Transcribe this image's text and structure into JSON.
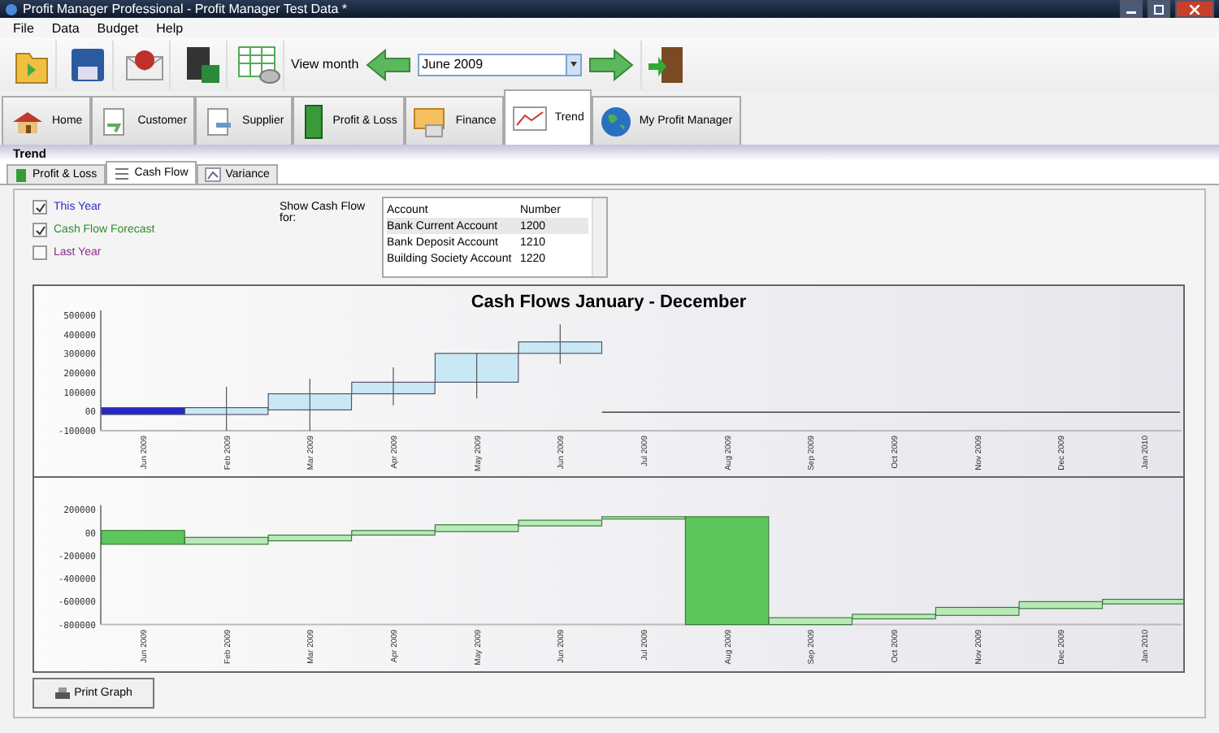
{
  "window": {
    "title": "Profit Manager Professional - Profit Manager Test Data *"
  },
  "menu": [
    "File",
    "Data",
    "Budget",
    "Help"
  ],
  "toolbar": {
    "view_month_label": "View month",
    "month": "June 2009"
  },
  "nav_tabs": [
    {
      "label": "Home",
      "selected": false
    },
    {
      "label": "Customer",
      "selected": false
    },
    {
      "label": "Supplier",
      "selected": false
    },
    {
      "label": "Profit & Loss",
      "selected": false
    },
    {
      "label": "Finance",
      "selected": false
    },
    {
      "label": "Trend",
      "selected": true
    },
    {
      "label": "My Profit Manager",
      "selected": false
    }
  ],
  "section_title": "Trend",
  "sub_tabs": [
    {
      "label": "Profit & Loss",
      "selected": false
    },
    {
      "label": "Cash Flow",
      "selected": true
    },
    {
      "label": "Variance",
      "selected": false
    }
  ],
  "series_toggles": [
    {
      "label": "This Year",
      "checked": true,
      "color": "#2b2bc8"
    },
    {
      "label": "Cash Flow Forecast",
      "checked": true,
      "color": "#2e8b2e"
    },
    {
      "label": "Last Year",
      "checked": false,
      "color": "#8a2b8a"
    }
  ],
  "show_cash_flow_label": "Show Cash Flow for:",
  "accounts": {
    "columns": [
      "Account",
      "Number"
    ],
    "rows": [
      {
        "cells": [
          "Bank Current Account",
          "1200"
        ],
        "selected": true
      },
      {
        "cells": [
          "Bank Deposit Account",
          "1210"
        ],
        "selected": false
      },
      {
        "cells": [
          "Building Society Account",
          "1220"
        ],
        "selected": false
      }
    ]
  },
  "charts": [
    {
      "kind": "cash-flow",
      "title": "Cash Flows January - December",
      "y_axis_labels": [
        "500000",
        "400000",
        "300000",
        "200000",
        "100000",
        "00",
        "-100000"
      ],
      "x_axis_labels": [
        "Jun 2009",
        "Feb 2009",
        "Mar 2009",
        "Apr 2009",
        "May 2009",
        "Jun 2009",
        "Jul 2009",
        "Aug 2009",
        "Sep 2009",
        "Oct 2009",
        "Nov 2009",
        "Dec 2009",
        "Jan 2010"
      ]
    },
    {
      "kind": "balance",
      "y_axis_labels": [
        "200000",
        "00",
        "-200000",
        "-400000",
        "-600000",
        "-800000"
      ],
      "x_axis_labels": [
        "Jun 2009",
        "Feb 2009",
        "Mar 2009",
        "Apr 2009",
        "May 2009",
        "Jun 2009",
        "Jul 2009",
        "Aug 2009",
        "Sep 2009",
        "Oct 2009",
        "Nov 2009",
        "Dec 2009",
        "Jan 2010"
      ]
    }
  ],
  "print_button": "Print Graph"
}
